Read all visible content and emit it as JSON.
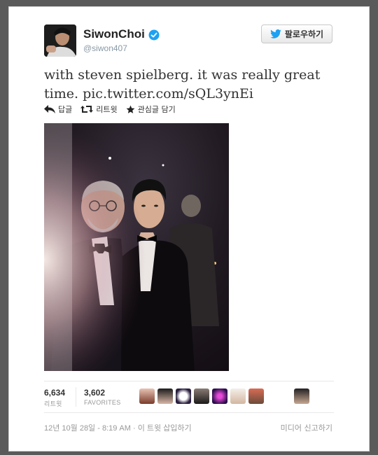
{
  "user": {
    "name": "SiwonChoi",
    "handle": "@siwon407",
    "verified": true
  },
  "follow_button": {
    "label": "팔로우하기",
    "icon": "twitter-bird-icon"
  },
  "tweet": {
    "text": "with steven spielberg. it was really great time.",
    "link": "pic.twitter.com/sQL3ynEi"
  },
  "actions": {
    "reply": "답글",
    "retweet": "리트윗",
    "favorite": "관심글 담기"
  },
  "stats": {
    "retweets_count": "6,634",
    "retweets_label": "리트윗",
    "favorites_count": "3,602",
    "favorites_label": "FAVORITES"
  },
  "meta": {
    "timestamp": "12년 10월 28일 - 8:19 AM",
    "embed": "이 트윗 삽입하기",
    "separator": " · ",
    "report_media": "미디어 신고하기"
  },
  "colors": {
    "accent": "#1da1f2",
    "text": "#333333",
    "muted": "#999999"
  }
}
